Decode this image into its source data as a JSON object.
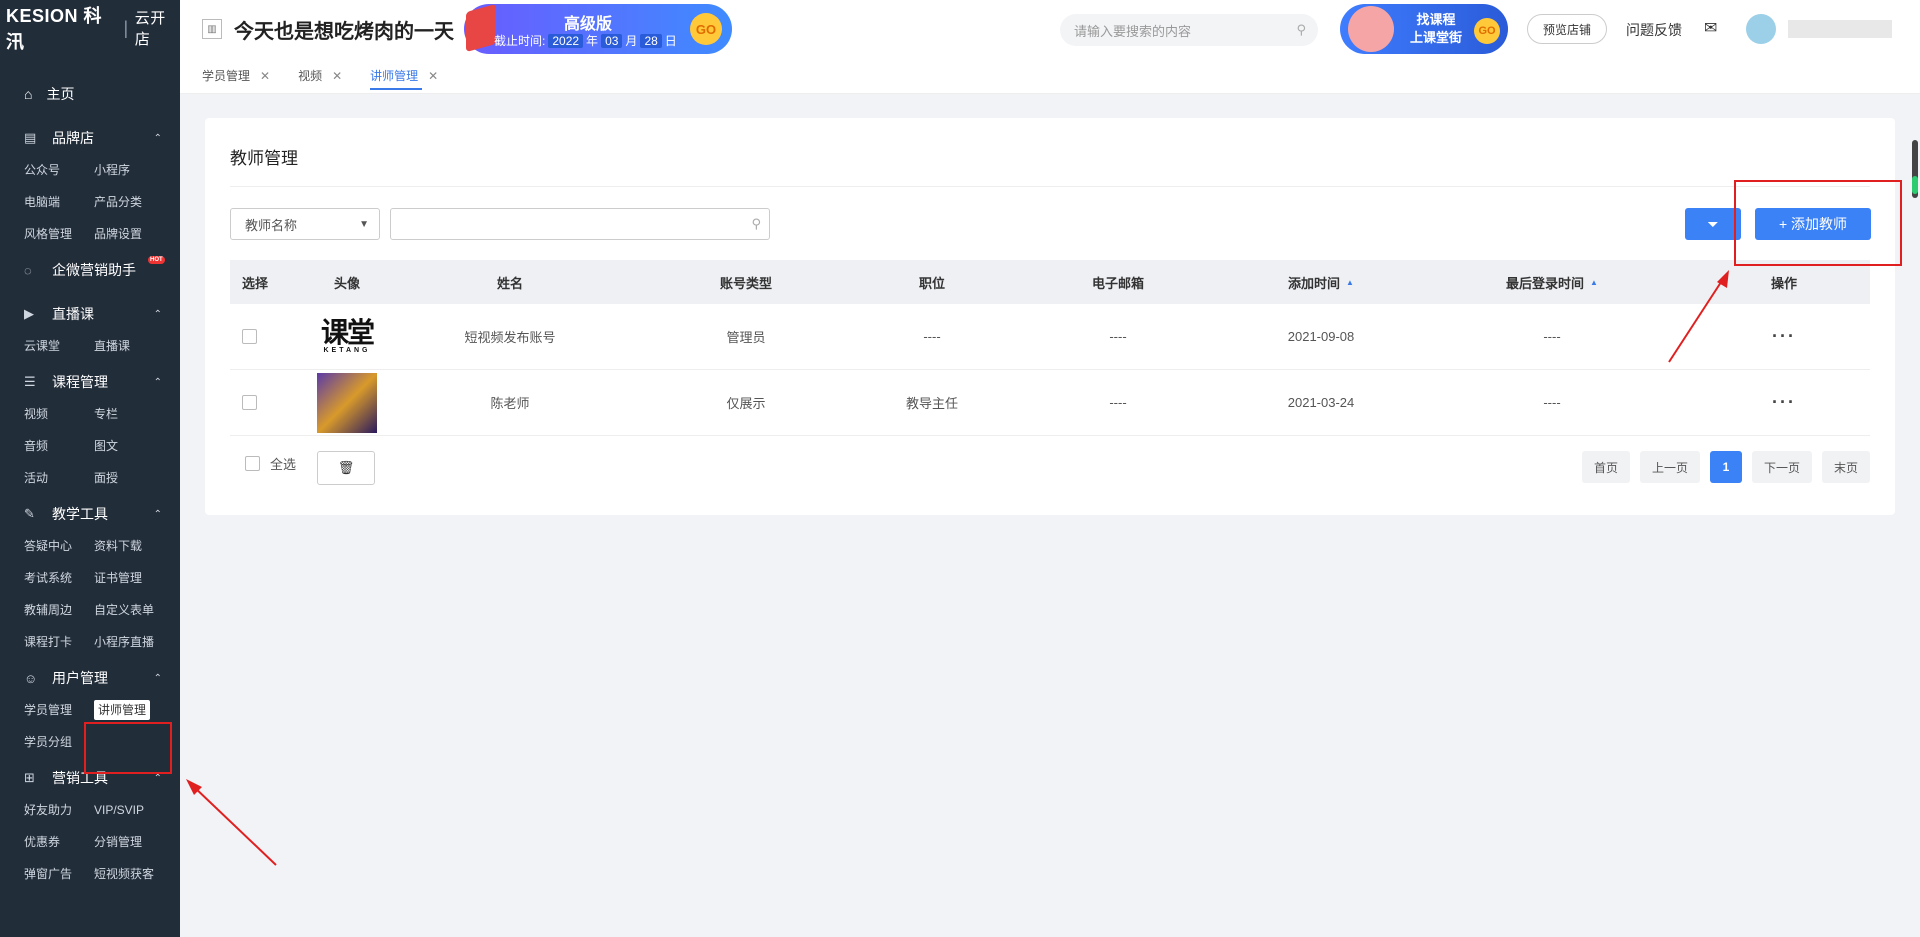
{
  "brand": {
    "logo": "KESION 科汛",
    "store": "云开店"
  },
  "sidebar": {
    "home": "主页",
    "groups": [
      {
        "label": "品牌店",
        "icon": "shop-icon",
        "items": [
          "公众号",
          "小程序",
          "电脑端",
          "产品分类",
          "风格管理",
          "品牌设置"
        ]
      },
      {
        "label": "企微营销助手",
        "icon": "wechat-icon",
        "badge": "HOT",
        "items": []
      },
      {
        "label": "直播课",
        "icon": "live-icon",
        "items": [
          "云课堂",
          "直播课"
        ]
      },
      {
        "label": "课程管理",
        "icon": "course-icon",
        "items": [
          "视频",
          "专栏",
          "音频",
          "图文",
          "活动",
          "面授"
        ]
      },
      {
        "label": "教学工具",
        "icon": "tools-icon",
        "items": [
          "答疑中心",
          "资料下载",
          "考试系统",
          "证书管理",
          "教辅周边",
          "自定义表单",
          "课程打卡",
          "小程序直播"
        ]
      },
      {
        "label": "用户管理",
        "icon": "user-icon",
        "items": [
          "学员管理",
          "讲师管理",
          "学员分组"
        ]
      },
      {
        "label": "营销工具",
        "icon": "gift-icon",
        "items": [
          "好友助力",
          "VIP/SVIP",
          "优惠券",
          "分销管理",
          "弹窗广告",
          "短视频获客"
        ]
      }
    ],
    "active_item": "讲师管理"
  },
  "topbar": {
    "site_title": "今天也是想吃烤肉的一天",
    "promo_version": "高级版",
    "promo_expire_label": "截止时间:",
    "promo_year": "2022",
    "promo_year_unit": "年",
    "promo_month": "03",
    "promo_month_unit": "月",
    "promo_day": "28",
    "promo_day_unit": "日",
    "promo_go": "GO",
    "search_placeholder": "请输入要搜索的内容",
    "promo2_line1": "找课程",
    "promo2_line2": "上课堂街",
    "promo2_go": "GO",
    "preview_label": "预览店铺",
    "feedback_label": "问题反馈"
  },
  "tabs": [
    {
      "label": "学员管理",
      "active": false
    },
    {
      "label": "视频",
      "active": false
    },
    {
      "label": "讲师管理",
      "active": true
    }
  ],
  "main": {
    "title": "教师管理",
    "filter_select_value": "教师名称",
    "filter_input_value": "",
    "add_button_label": "+ 添加教师",
    "columns": [
      "选择",
      "头像",
      "姓名",
      "账号类型",
      "职位",
      "电子邮箱",
      "添加时间",
      "最后登录时间",
      "操作"
    ],
    "rows": [
      {
        "name": "短视频发布账号",
        "account_type": "管理员",
        "position": "----",
        "email": "----",
        "added": "2021-09-08",
        "last_login": "----",
        "avatar_text": "课堂",
        "avatar_sub": "KETANG"
      },
      {
        "name": "陈老师",
        "account_type": "仅展示",
        "position": "教导主任",
        "email": "----",
        "added": "2021-03-24",
        "last_login": "----"
      }
    ],
    "select_all_label": "全选",
    "pager": {
      "first": "首页",
      "prev": "上一页",
      "current": "1",
      "next": "下一页",
      "last": "末页"
    }
  },
  "colors": {
    "sidebar_bg": "#222d3a",
    "primary": "#3b82f6",
    "annotation_red": "#e02020"
  }
}
